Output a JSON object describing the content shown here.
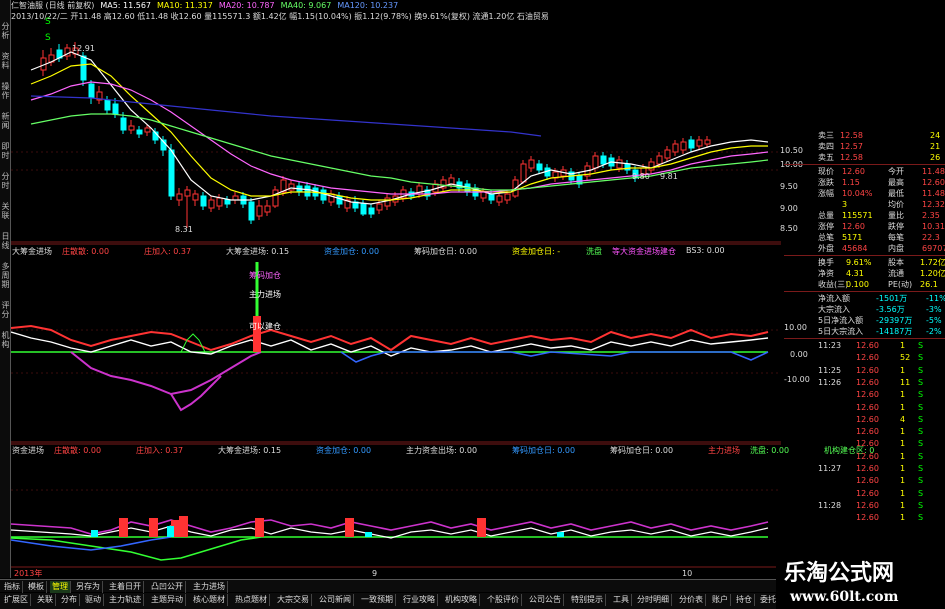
{
  "window": {
    "title": "仁智油服 (日线 前复权)"
  },
  "info_line": [
    {
      "t": "仁智油服 (日线 前复权)",
      "c": "#dddddd"
    },
    {
      "t": "MA5: 11.567",
      "c": "#ffffff"
    },
    {
      "t": "MA10: 11.317",
      "c": "#ffff00"
    },
    {
      "t": "MA20: 10.787",
      "c": "#ff66ff"
    },
    {
      "t": "MA40: 9.067",
      "c": "#66ff66"
    },
    {
      "t": "MA120: 10.237",
      "c": "#6699ff"
    }
  ],
  "info_line2": "2013/10/22/二 开11.48 高12.60 低11.48 收12.60 量115571.3 额1.42亿 幅1.15(10.04%) 振1.12(9.78%) 换9.61%(复权) 流通1.20亿 石油贸易",
  "price_labels": {
    "high": "12.91",
    "low": "8.31",
    "mark1": "9.80",
    "mark2": "9.81"
  },
  "panel1": {
    "items": [
      {
        "t": "大筹金进场",
        "c": "#dddddd"
      },
      {
        "t": "庄散散: 0.00",
        "c": "#ff4444"
      },
      {
        "t": "庄加入: 0.37",
        "c": "#ff4444"
      },
      {
        "t": "大筹金进场: 0.15",
        "c": "#dddddd"
      },
      {
        "t": "资金加仓: 0.00",
        "c": "#3399ff"
      },
      {
        "t": "筹码加仓日: 0.00",
        "c": "#dddddd"
      },
      {
        "t": "资金加仓日: -",
        "c": "#ffff00"
      },
      {
        "t": "洗盘",
        "c": "#55ff55"
      },
      {
        "t": "等大资金进场建仓",
        "c": "#ff55ff"
      },
      {
        "t": "BS3: 0.00",
        "c": "#dddddd"
      }
    ],
    "annotations": [
      "筹码加仓",
      "主力进场",
      "可以建仓"
    ],
    "y_labels": [
      "10.00",
      "0.00",
      "-10.00"
    ]
  },
  "panel2": {
    "items": [
      {
        "t": "资金进场",
        "c": "#dddddd"
      },
      {
        "t": "庄散散: 0.00",
        "c": "#ff4444"
      },
      {
        "t": "庄加入: 0.37",
        "c": "#ff4444"
      },
      {
        "t": "大筹金进场: 0.15",
        "c": "#dddddd"
      },
      {
        "t": "资金加仓: 0.00",
        "c": "#3399ff"
      },
      {
        "t": "主力资金出场: 0.00",
        "c": "#dddddd"
      },
      {
        "t": "筹码加仓日: 0.00",
        "c": "#3399ff"
      },
      {
        "t": "筹码加仓日: 0.00",
        "c": "#dddddd"
      },
      {
        "t": "主力进场",
        "c": "#ff4444"
      },
      {
        "t": "洗盘: 0.00",
        "c": "#55ff55"
      },
      {
        "t": "机构建仓区: 0",
        "c": "#55ff55"
      }
    ]
  },
  "price_axis": [
    "10.50",
    "10.00",
    "9.50",
    "9.00",
    "8.50"
  ],
  "x_axis": [
    "2013年",
    "9",
    "10"
  ],
  "left_tabs": [
    "分析",
    "资料",
    "操作",
    "新闻",
    "即时",
    "分时",
    "关联",
    "日线",
    "多周期",
    "评分",
    "机构"
  ],
  "right_panel": {
    "asks": [
      {
        "l": "卖三",
        "p": "12.58",
        "v": "24"
      },
      {
        "l": "卖四",
        "p": "12.57",
        "v": "21"
      },
      {
        "l": "卖五",
        "p": "12.58",
        "v": "26"
      }
    ],
    "quote": [
      {
        "a": "现价",
        "b": "12.60",
        "c": "今开",
        "d": "11.48"
      },
      {
        "a": "涨跌",
        "b": "1.15",
        "c": "最高",
        "d": "12.60"
      },
      {
        "a": "涨幅",
        "b": "10.04%",
        "c": "最低",
        "d": "11.48"
      },
      {
        "a": "",
        "b": "3",
        "c": "均价",
        "d": "12.32"
      },
      {
        "a": "总量",
        "b": "115571",
        "c": "量比",
        "d": "2.35"
      },
      {
        "a": "涨停",
        "b": "12.60",
        "c": "跌停",
        "d": "10.31"
      },
      {
        "a": "总笔",
        "b": "5171",
        "c": "每笔",
        "d": "22.3"
      },
      {
        "a": "外盘",
        "b": "45684",
        "c": "内盘",
        "d": "69707"
      }
    ],
    "stats": [
      {
        "a": "换手",
        "b": "9.61%",
        "c": "股本",
        "d": "1.72亿"
      },
      {
        "a": "净资",
        "b": "4.31",
        "c": "流通",
        "d": "1.20亿"
      },
      {
        "a": "收益(三)",
        "b": "0.100",
        "c": "PE(动)",
        "d": "26.1"
      }
    ],
    "flows": [
      {
        "a": "净流入额",
        "b": "-1501万",
        "c": "-11%"
      },
      {
        "a": "大宗流入",
        "b": "-3.56万",
        "c": "-3%"
      },
      {
        "a": "5日净流入额",
        "b": "-29397万",
        "c": "-5%"
      },
      {
        "a": "5日大宗流入",
        "b": "-14187万",
        "c": "-2%"
      }
    ],
    "ticks": [
      {
        "t": "11:23",
        "p": "12.60",
        "v": "1",
        "f": "S"
      },
      {
        "t": "",
        "p": "12.60",
        "v": "52",
        "f": "S"
      },
      {
        "t": "11:25",
        "p": "12.60",
        "v": "1",
        "f": "S"
      },
      {
        "t": "11:26",
        "p": "12.60",
        "v": "11",
        "f": "S"
      },
      {
        "t": "",
        "p": "12.60",
        "v": "1",
        "f": "S"
      },
      {
        "t": "",
        "p": "12.60",
        "v": "1",
        "f": "S"
      },
      {
        "t": "",
        "p": "12.60",
        "v": "4",
        "f": "S"
      },
      {
        "t": "",
        "p": "12.60",
        "v": "1",
        "f": "S"
      },
      {
        "t": "",
        "p": "12.60",
        "v": "1",
        "f": "S"
      },
      {
        "t": "",
        "p": "12.60",
        "v": "1",
        "f": "S"
      },
      {
        "t": "11:27",
        "p": "12.60",
        "v": "1",
        "f": "S"
      },
      {
        "t": "",
        "p": "12.60",
        "v": "1",
        "f": "S"
      },
      {
        "t": "",
        "p": "12.60",
        "v": "1",
        "f": "S"
      },
      {
        "t": "11:28",
        "p": "12.60",
        "v": "1",
        "f": "S"
      },
      {
        "t": "",
        "p": "12.60",
        "v": "1",
        "f": "S"
      }
    ]
  },
  "tabs_row1": [
    "指标",
    "模板",
    "管理",
    "另存为",
    "主着日开",
    "凸凹公开",
    "主力进场"
  ],
  "tabs_row2": [
    "扩展区",
    "关联",
    "分布",
    "驱动",
    "主力轨迹",
    "主题异动",
    "核心题材",
    "热点题材",
    "大宗交易",
    "公司新闻",
    "一致预期",
    "行业攻略",
    "机构攻略",
    "个股评价",
    "公司公告",
    "特别提示",
    "工具",
    "分时明细",
    "分价表",
    "账户",
    "持仓",
    "委托"
  ],
  "watermark": {
    "title": "乐淘公式网",
    "url": "www.60lt.com"
  },
  "colors": {
    "up": "#ff3333",
    "down": "#00ffff",
    "grid": "#7a1a1a",
    "ma5": "#ffffff",
    "ma10": "#ffff00",
    "ma20": "#ff66ff",
    "ma40": "#66ff66",
    "ma120": "#3333cc"
  }
}
